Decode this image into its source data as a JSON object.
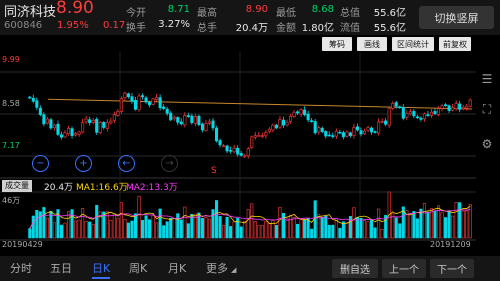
{
  "header": {
    "stock_name": "同济科技",
    "price": "8.90",
    "code": "600846",
    "change_pct": "1.95%",
    "change_amt": "0.17",
    "quotes": [
      {
        "label": "今开",
        "value": "8.71",
        "color": "green"
      },
      {
        "label": "最高",
        "value": "8.90",
        "color": "red"
      },
      {
        "label": "最低",
        "value": "8.68",
        "color": "green"
      },
      {
        "label": "总值",
        "value": "55.6亿",
        "color": "white"
      },
      {
        "label": "换手",
        "value": "3.27%",
        "color": "white"
      },
      {
        "label": "总手",
        "value": "20.4万",
        "color": "white"
      },
      {
        "label": "金额",
        "value": "1.80亿",
        "color": "white"
      },
      {
        "label": "流值",
        "value": "55.6亿",
        "color": "white"
      }
    ],
    "switch_label": "切换竖屏"
  },
  "toolbar": {
    "chip_label": "筹码",
    "draw_label": "画线",
    "stats_label": "区间统计",
    "adjust_label": "前复权"
  },
  "side_icons": [
    "menu-icon",
    "fullscreen-icon",
    "settings-icon"
  ],
  "axis": {
    "y_top": "9.99",
    "y_mid": "8.58",
    "y_low": "7.17",
    "vol_top": "46万",
    "date_start": "20190429",
    "date_end": "20191209"
  },
  "markers": {
    "low_marker": "S"
  },
  "nav": [
    "zoom-out",
    "zoom-in",
    "scroll-left",
    "scroll-right"
  ],
  "volume": {
    "tag": "成交量",
    "value": "20.4万",
    "ma1": "MA1:16.6万",
    "ma2": "MA2:13.3万",
    "ma1_color": "#ffd700",
    "ma2_color": "#ff3bff"
  },
  "colors": {
    "up": "#ff3b3b",
    "down": "#00d9e8",
    "accent": "#3a6fff"
  },
  "tabs": [
    {
      "label": "分时",
      "active": false
    },
    {
      "label": "五日",
      "active": false
    },
    {
      "label": "日K",
      "active": true
    },
    {
      "label": "周K",
      "active": false
    },
    {
      "label": "月K",
      "active": false
    },
    {
      "label": "更多",
      "active": false
    }
  ],
  "bottom_buttons": {
    "delete_label": "删自选",
    "prev_label": "上一个",
    "next_label": "下一个"
  },
  "chart_data": {
    "type": "candlestick",
    "x_start": "20190429",
    "x_end": "20191209",
    "ylim": [
      7.17,
      9.99
    ],
    "closes": [
      8.95,
      8.87,
      8.72,
      8.54,
      8.31,
      8.43,
      8.21,
      8.28,
      8.05,
      7.98,
      8.09,
      8.2,
      8.02,
      8.07,
      8.11,
      8.34,
      8.43,
      8.34,
      8.4,
      8.1,
      8.34,
      8.22,
      8.34,
      8.38,
      8.54,
      8.62,
      8.94,
      9.07,
      8.98,
      8.87,
      8.67,
      9.0,
      8.98,
      8.85,
      8.78,
      8.93,
      8.96,
      8.71,
      8.69,
      8.57,
      8.41,
      8.48,
      8.35,
      8.31,
      8.52,
      8.49,
      8.34,
      8.5,
      8.29,
      8.16,
      8.32,
      8.36,
      8.21,
      7.89,
      7.79,
      7.77,
      7.64,
      7.64,
      7.71,
      7.56,
      7.53,
      7.52,
      7.7,
      7.99,
      8.02,
      8.03,
      8.02,
      8.1,
      8.18,
      8.28,
      8.21,
      8.42,
      8.28,
      8.35,
      8.5,
      8.6,
      8.58,
      8.66,
      8.54,
      8.41,
      8.37,
      8.09,
      8.22,
      8.12,
      8.01,
      8.03,
      8.0,
      8.13,
      8.1,
      7.99,
      8.11,
      8.02,
      8.22,
      8.16,
      8.06,
      8.13,
      8.22,
      8.11,
      8.11,
      8.36,
      8.37,
      8.3,
      8.69,
      8.82,
      8.75,
      8.71,
      8.45,
      8.57,
      8.61,
      8.51,
      8.46,
      8.42,
      8.56,
      8.52,
      8.6,
      8.56,
      8.69,
      8.76,
      8.77,
      8.64,
      8.71,
      8.81,
      8.67,
      8.72,
      8.75,
      8.9
    ],
    "volume_max": "46万"
  }
}
